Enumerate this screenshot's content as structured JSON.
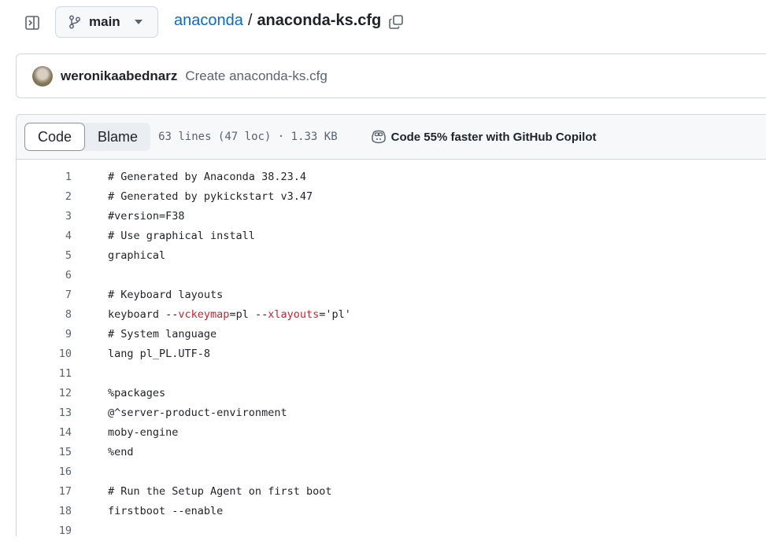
{
  "nav": {
    "branch": "main",
    "repo": "anaconda",
    "separator": "/",
    "file": "anaconda-ks.cfg"
  },
  "commit": {
    "author": "weronikaabednarz",
    "message": "Create anaconda-ks.cfg"
  },
  "file_header": {
    "tabs": [
      "Code",
      "Blame"
    ],
    "active_tab": "Code",
    "meta": "63 lines (47 loc) · 1.33 KB",
    "copilot": "Code 55% faster with GitHub Copilot"
  },
  "code": {
    "lines": [
      {
        "n": "1",
        "text": "# Generated by Anaconda 38.23.4"
      },
      {
        "n": "2",
        "text": "# Generated by pykickstart v3.47"
      },
      {
        "n": "3",
        "text": "#version=F38"
      },
      {
        "n": "4",
        "text": "# Use graphical install"
      },
      {
        "n": "5",
        "text": "graphical"
      },
      {
        "n": "6",
        "text": ""
      },
      {
        "n": "7",
        "text": "# Keyboard layouts"
      },
      {
        "n": "8",
        "pre": "keyboard --",
        "k1": "vckeymap",
        "mid": "=pl --",
        "k2": "xlayouts",
        "post": "='pl'"
      },
      {
        "n": "9",
        "text": "# System language"
      },
      {
        "n": "10",
        "text": "lang pl_PL.UTF-8"
      },
      {
        "n": "11",
        "text": ""
      },
      {
        "n": "12",
        "text": "%packages"
      },
      {
        "n": "13",
        "text": "@^server-product-environment"
      },
      {
        "n": "14",
        "text": "moby-engine"
      },
      {
        "n": "15",
        "text": "%end"
      },
      {
        "n": "16",
        "text": ""
      },
      {
        "n": "17",
        "text": "# Run the Setup Agent on first boot"
      },
      {
        "n": "18",
        "text": "firstboot --enable"
      },
      {
        "n": "19",
        "text": ""
      }
    ]
  },
  "colors": {
    "link": "#0969da",
    "keyword": "#cf222e",
    "muted": "#59636e"
  }
}
